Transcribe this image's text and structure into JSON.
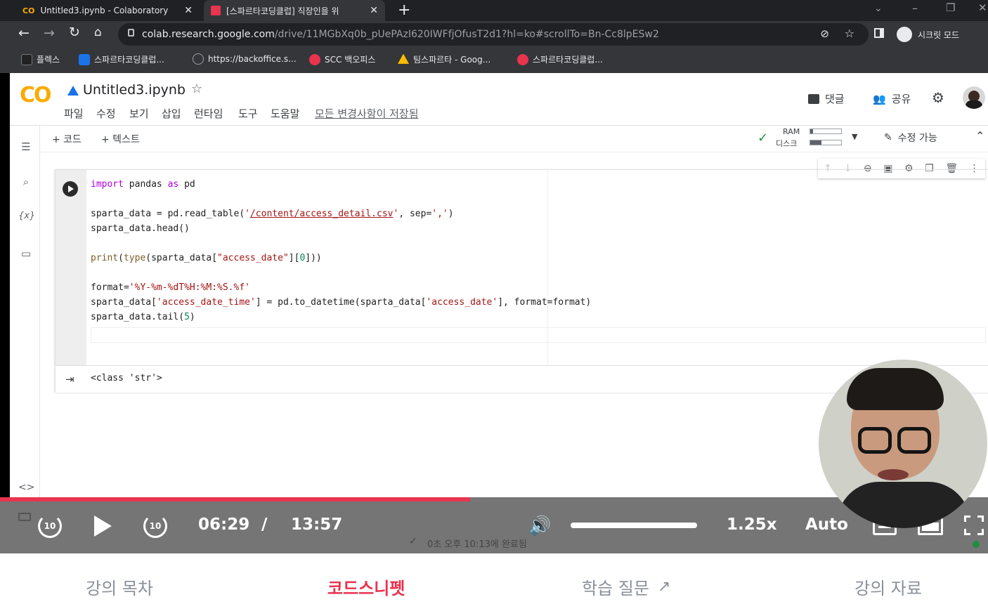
{
  "browser": {
    "tabs": [
      {
        "title": "Untitled3.ipynb - Colaboratory",
        "active": false
      },
      {
        "title": "[스파르타코딩클럽] 직장인을 위",
        "active": true
      }
    ],
    "url_host": "colab.research.google.com",
    "url_path": "/drive/11MGbXq0b_pUePAzI620IWFfjOfusT2d1?hl=ko#scrollTo=Bn-Cc8lpESw2",
    "profile_label": "시크릿 모드",
    "bookmarks": [
      {
        "label": "플렉스",
        "color": "#333333"
      },
      {
        "label": "스파르타코딩클럽...",
        "color": "#1a73e8"
      },
      {
        "label": "https://backoffice.s...",
        "color": "#5f6368"
      },
      {
        "label": "SCC 백오피스",
        "color": "#e8344e"
      },
      {
        "label": "팀스파르타 - Goog...",
        "color": "#fbbc04"
      },
      {
        "label": "스파르타코딩클럽...",
        "color": "#e8344e"
      }
    ]
  },
  "colab": {
    "logo": "CO",
    "notebook_title": "Untitled3.ipynb",
    "menu": [
      "파일",
      "수정",
      "보기",
      "삽입",
      "런타임",
      "도구",
      "도움말"
    ],
    "save_status": "모든 변경사항이 저장됨",
    "comment_label": "댓글",
    "share_label": "공유",
    "add_code": "+ 코드",
    "add_text": "+ 텍스트",
    "ram_label": "RAM",
    "disk_label": "디스크",
    "edit_label": "수정 가능",
    "code_lines": [
      "import pandas as pd",
      "",
      "sparta_data = pd.read_table('/content/access_detail.csv', sep=',')",
      "sparta_data.head()",
      "",
      "print(type(sparta_data[\"access_date\"][0]))",
      "",
      "format='%Y-%m-%dT%H:%M:%S.%f'",
      "sparta_data['access_date_time'] = pd.to_datetime(sparta_data['access_date'], format=format)",
      "sparta_data.tail(5)"
    ],
    "output_text": "<class 'str'>",
    "status_bar": "0초   오후 10:13에 완료됨"
  },
  "video": {
    "current_time": "06:29",
    "separator": "/",
    "total_time": "13:57",
    "speed": "1.25x",
    "quality": "Auto",
    "skip_back": "10",
    "skip_forward": "10",
    "progress": 0.476,
    "volume": 1.0
  },
  "bottom_tabs": [
    {
      "label": "강의 목차",
      "active": false
    },
    {
      "label": "코드스니펫",
      "active": true
    },
    {
      "label": "학습 질문",
      "active": false
    },
    {
      "label": "강의 자료",
      "active": false
    }
  ],
  "colors": {
    "accent": "#e8344e",
    "colab_orange": "#f9ab00"
  }
}
